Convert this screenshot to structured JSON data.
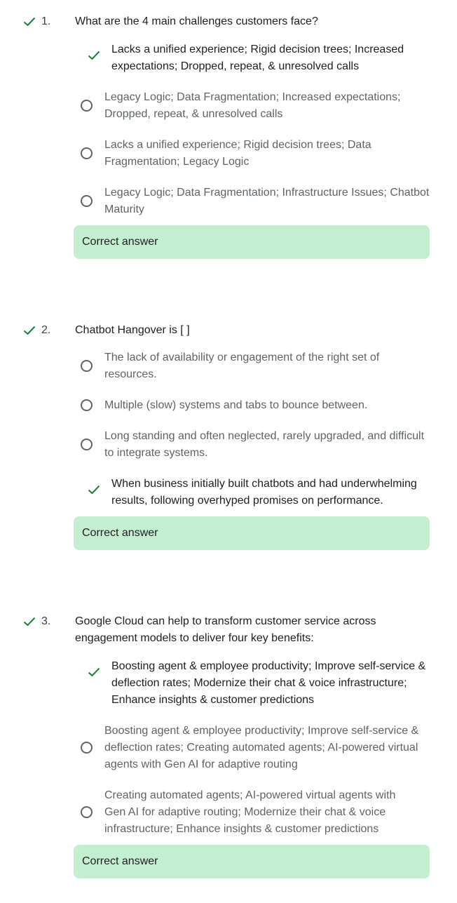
{
  "colors": {
    "check": "#188038",
    "feedback_bg": "#c4eed0",
    "radio_border": "#5f6368"
  },
  "questions": [
    {
      "number": "1.",
      "status_icon": "checkmark-icon",
      "text": "What are the 4 main challenges customers face?",
      "options": [
        {
          "label": "Lacks a unified experience; Rigid decision trees; Increased expectations; Dropped, repeat, & unresolved calls",
          "selected": true,
          "correct": true
        },
        {
          "label": "Legacy Logic; Data Fragmentation; Increased expectations; Dropped, repeat, & unresolved calls",
          "selected": false
        },
        {
          "label": "Lacks a unified experience; Rigid decision trees; Data Fragmentation; Legacy Logic",
          "selected": false
        },
        {
          "label": "Legacy Logic; Data Fragmentation; Infrastructure Issues; Chatbot Maturity",
          "selected": false
        }
      ],
      "feedback": "Correct answer"
    },
    {
      "number": "2.",
      "status_icon": "checkmark-icon",
      "text": "Chatbot Hangover is [ ]",
      "options": [
        {
          "label": "The lack of availability or engagement of the right set of resources.",
          "selected": false
        },
        {
          "label": "Multiple (slow) systems and tabs to bounce between.",
          "selected": false
        },
        {
          "label": "Long standing and often neglected, rarely upgraded, and difficult to integrate systems.",
          "selected": false
        },
        {
          "label": "When business initially built chatbots and had underwhelming results, following overhyped promises on performance.",
          "selected": true,
          "correct": true
        }
      ],
      "feedback": "Correct answer"
    },
    {
      "number": "3.",
      "status_icon": "checkmark-icon",
      "text": "Google Cloud can help to transform customer service across engagement models to deliver four key benefits:",
      "options": [
        {
          "label": "Boosting agent & employee productivity; Improve self-service & deflection rates; Modernize their chat & voice infrastructure; Enhance insights & customer predictions",
          "selected": true,
          "correct": true
        },
        {
          "label": "Boosting agent & employee productivity; Improve self-service & deflection rates; Creating automated agents; AI-powered virtual agents with Gen AI for adaptive routing",
          "selected": false
        },
        {
          "label": "Creating automated agents; AI-powered virtual agents with Gen AI for adaptive routing; Modernize their chat & voice infrastructure; Enhance insights & customer predictions",
          "selected": false
        }
      ],
      "feedback": "Correct answer"
    }
  ]
}
